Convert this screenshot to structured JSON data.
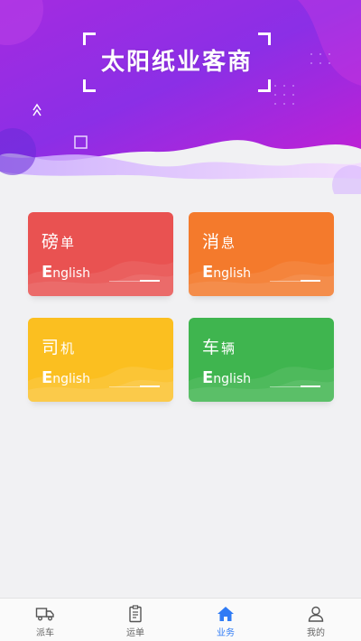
{
  "header": {
    "title": "太阳纸业客商"
  },
  "cards": [
    {
      "title_big": "磅",
      "title_small": "单",
      "en_first": "E",
      "en_rest": "nglish",
      "color": "#e95251"
    },
    {
      "title_big": "消",
      "title_small": "息",
      "en_first": "E",
      "en_rest": "nglish",
      "color": "#f47a2c"
    },
    {
      "title_big": "司",
      "title_small": "机",
      "en_first": "E",
      "en_rest": "nglish",
      "color": "#fbbf20"
    },
    {
      "title_big": "车",
      "title_small": "辆",
      "en_first": "E",
      "en_rest": "nglish",
      "color": "#3fb54f"
    }
  ],
  "tabbar": {
    "tabs": [
      {
        "label": "派车",
        "icon": "truck-icon"
      },
      {
        "label": "运单",
        "icon": "clipboard-icon"
      },
      {
        "label": "业务",
        "icon": "home-icon",
        "active": true
      },
      {
        "label": "我的",
        "icon": "user-icon"
      }
    ],
    "active_color": "#2f7bf5"
  },
  "theme": {
    "hero_purple": "#8a2be2",
    "hero_magenta": "#c81fd0",
    "background": "#f1f1f3"
  }
}
